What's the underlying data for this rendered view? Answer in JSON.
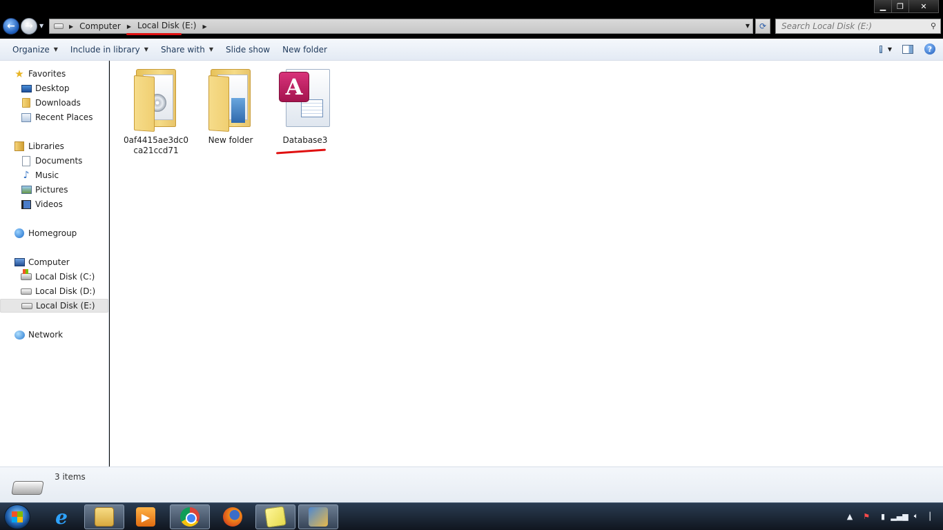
{
  "window": {
    "controls": {
      "minimize": "▁",
      "maximize": "❐",
      "close": "✕"
    }
  },
  "address_bar": {
    "crumbs": [
      "Computer",
      "Local Disk (E:)"
    ],
    "search_placeholder": "Search Local Disk (E:)"
  },
  "toolbar": {
    "organize": "Organize",
    "include_in_library": "Include in library",
    "share_with": "Share with",
    "slide_show": "Slide show",
    "new_folder": "New folder"
  },
  "sidebar": {
    "favorites": {
      "label": "Favorites",
      "items": [
        "Desktop",
        "Downloads",
        "Recent Places"
      ]
    },
    "libraries": {
      "label": "Libraries",
      "items": [
        "Documents",
        "Music",
        "Pictures",
        "Videos"
      ]
    },
    "homegroup": "Homegroup",
    "computer": {
      "label": "Computer",
      "items": [
        "Local Disk (C:)",
        "Local Disk (D:)",
        "Local Disk (E:)"
      ],
      "selected": "Local Disk (E:)"
    },
    "network": "Network"
  },
  "files": [
    {
      "name": "0af4415ae3dc0ca21ccd71",
      "type": "folder"
    },
    {
      "name": "New folder",
      "type": "folder"
    },
    {
      "name": "Database3",
      "type": "access-database"
    }
  ],
  "details": {
    "item_count": "3 items"
  },
  "colors": {
    "highlight_underline": "#e01010",
    "selected_nav_bg": "#e6e6e6",
    "command_text": "#1e395b"
  },
  "taskbar": {
    "pinned": [
      "internet-explorer-icon",
      "windows-explorer-icon",
      "media-player-icon",
      "chrome-icon",
      "firefox-icon",
      "sticky-notes-icon",
      "ccleaner-icon"
    ],
    "active": "windows-explorer-icon"
  }
}
